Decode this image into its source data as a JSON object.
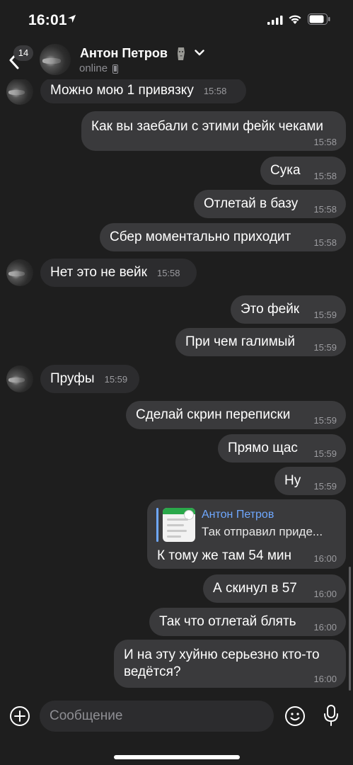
{
  "status_bar": {
    "time": "16:01"
  },
  "header": {
    "unread_badge": "14",
    "contact_name": "Антон Петров",
    "contact_emoji": "🗿",
    "status": "online"
  },
  "messages": [
    {
      "dir": "in",
      "text": "Можно мою 1 привязку",
      "time": "15:58"
    },
    {
      "dir": "out",
      "text": "Как вы заебали с этими фейк чеками",
      "time": "15:58"
    },
    {
      "dir": "out",
      "text": "Сука",
      "time": "15:58"
    },
    {
      "dir": "out",
      "text": "Отлетай в базу",
      "time": "15:58"
    },
    {
      "dir": "out",
      "text": "Сбер моментально приходит",
      "time": "15:58"
    },
    {
      "dir": "in",
      "text": "Нет это не вейк",
      "time": "15:58"
    },
    {
      "dir": "out",
      "text": "Это фейк",
      "time": "15:59"
    },
    {
      "dir": "out",
      "text": "При чем галимый",
      "time": "15:59"
    },
    {
      "dir": "in",
      "text": "Пруфы",
      "time": "15:59"
    },
    {
      "dir": "out",
      "text": "Сделай скрин переписки",
      "time": "15:59"
    },
    {
      "dir": "out",
      "text": "Прямо щас",
      "time": "15:59"
    },
    {
      "dir": "out",
      "text": "Ну",
      "time": "15:59"
    },
    {
      "dir": "out",
      "reply_author": "Антон Петров",
      "reply_text": "Так отправил приде...",
      "text": "К тому же там 54 мин",
      "time": "16:00"
    },
    {
      "dir": "out",
      "text": "А скинул в 57",
      "time": "16:00"
    },
    {
      "dir": "out",
      "text": "Так что отлетай блять",
      "time": "16:00"
    },
    {
      "dir": "out",
      "text": "И на эту хуйню серьезно кто-то ведётся?",
      "time": "16:00"
    }
  ],
  "composer": {
    "placeholder": "Сообщение"
  },
  "colors": {
    "background": "#1e1e1e",
    "incoming_bubble": "#2c2c2e",
    "outgoing_bubble": "#3a3a3c",
    "link_blue": "#6fa8ff"
  },
  "icons": [
    "location-arrow-icon",
    "signal-icon",
    "wifi-icon",
    "battery-icon",
    "back-chevron-icon",
    "chevron-down-icon",
    "phone-icon",
    "plus-icon",
    "smiley-icon",
    "microphone-icon"
  ]
}
